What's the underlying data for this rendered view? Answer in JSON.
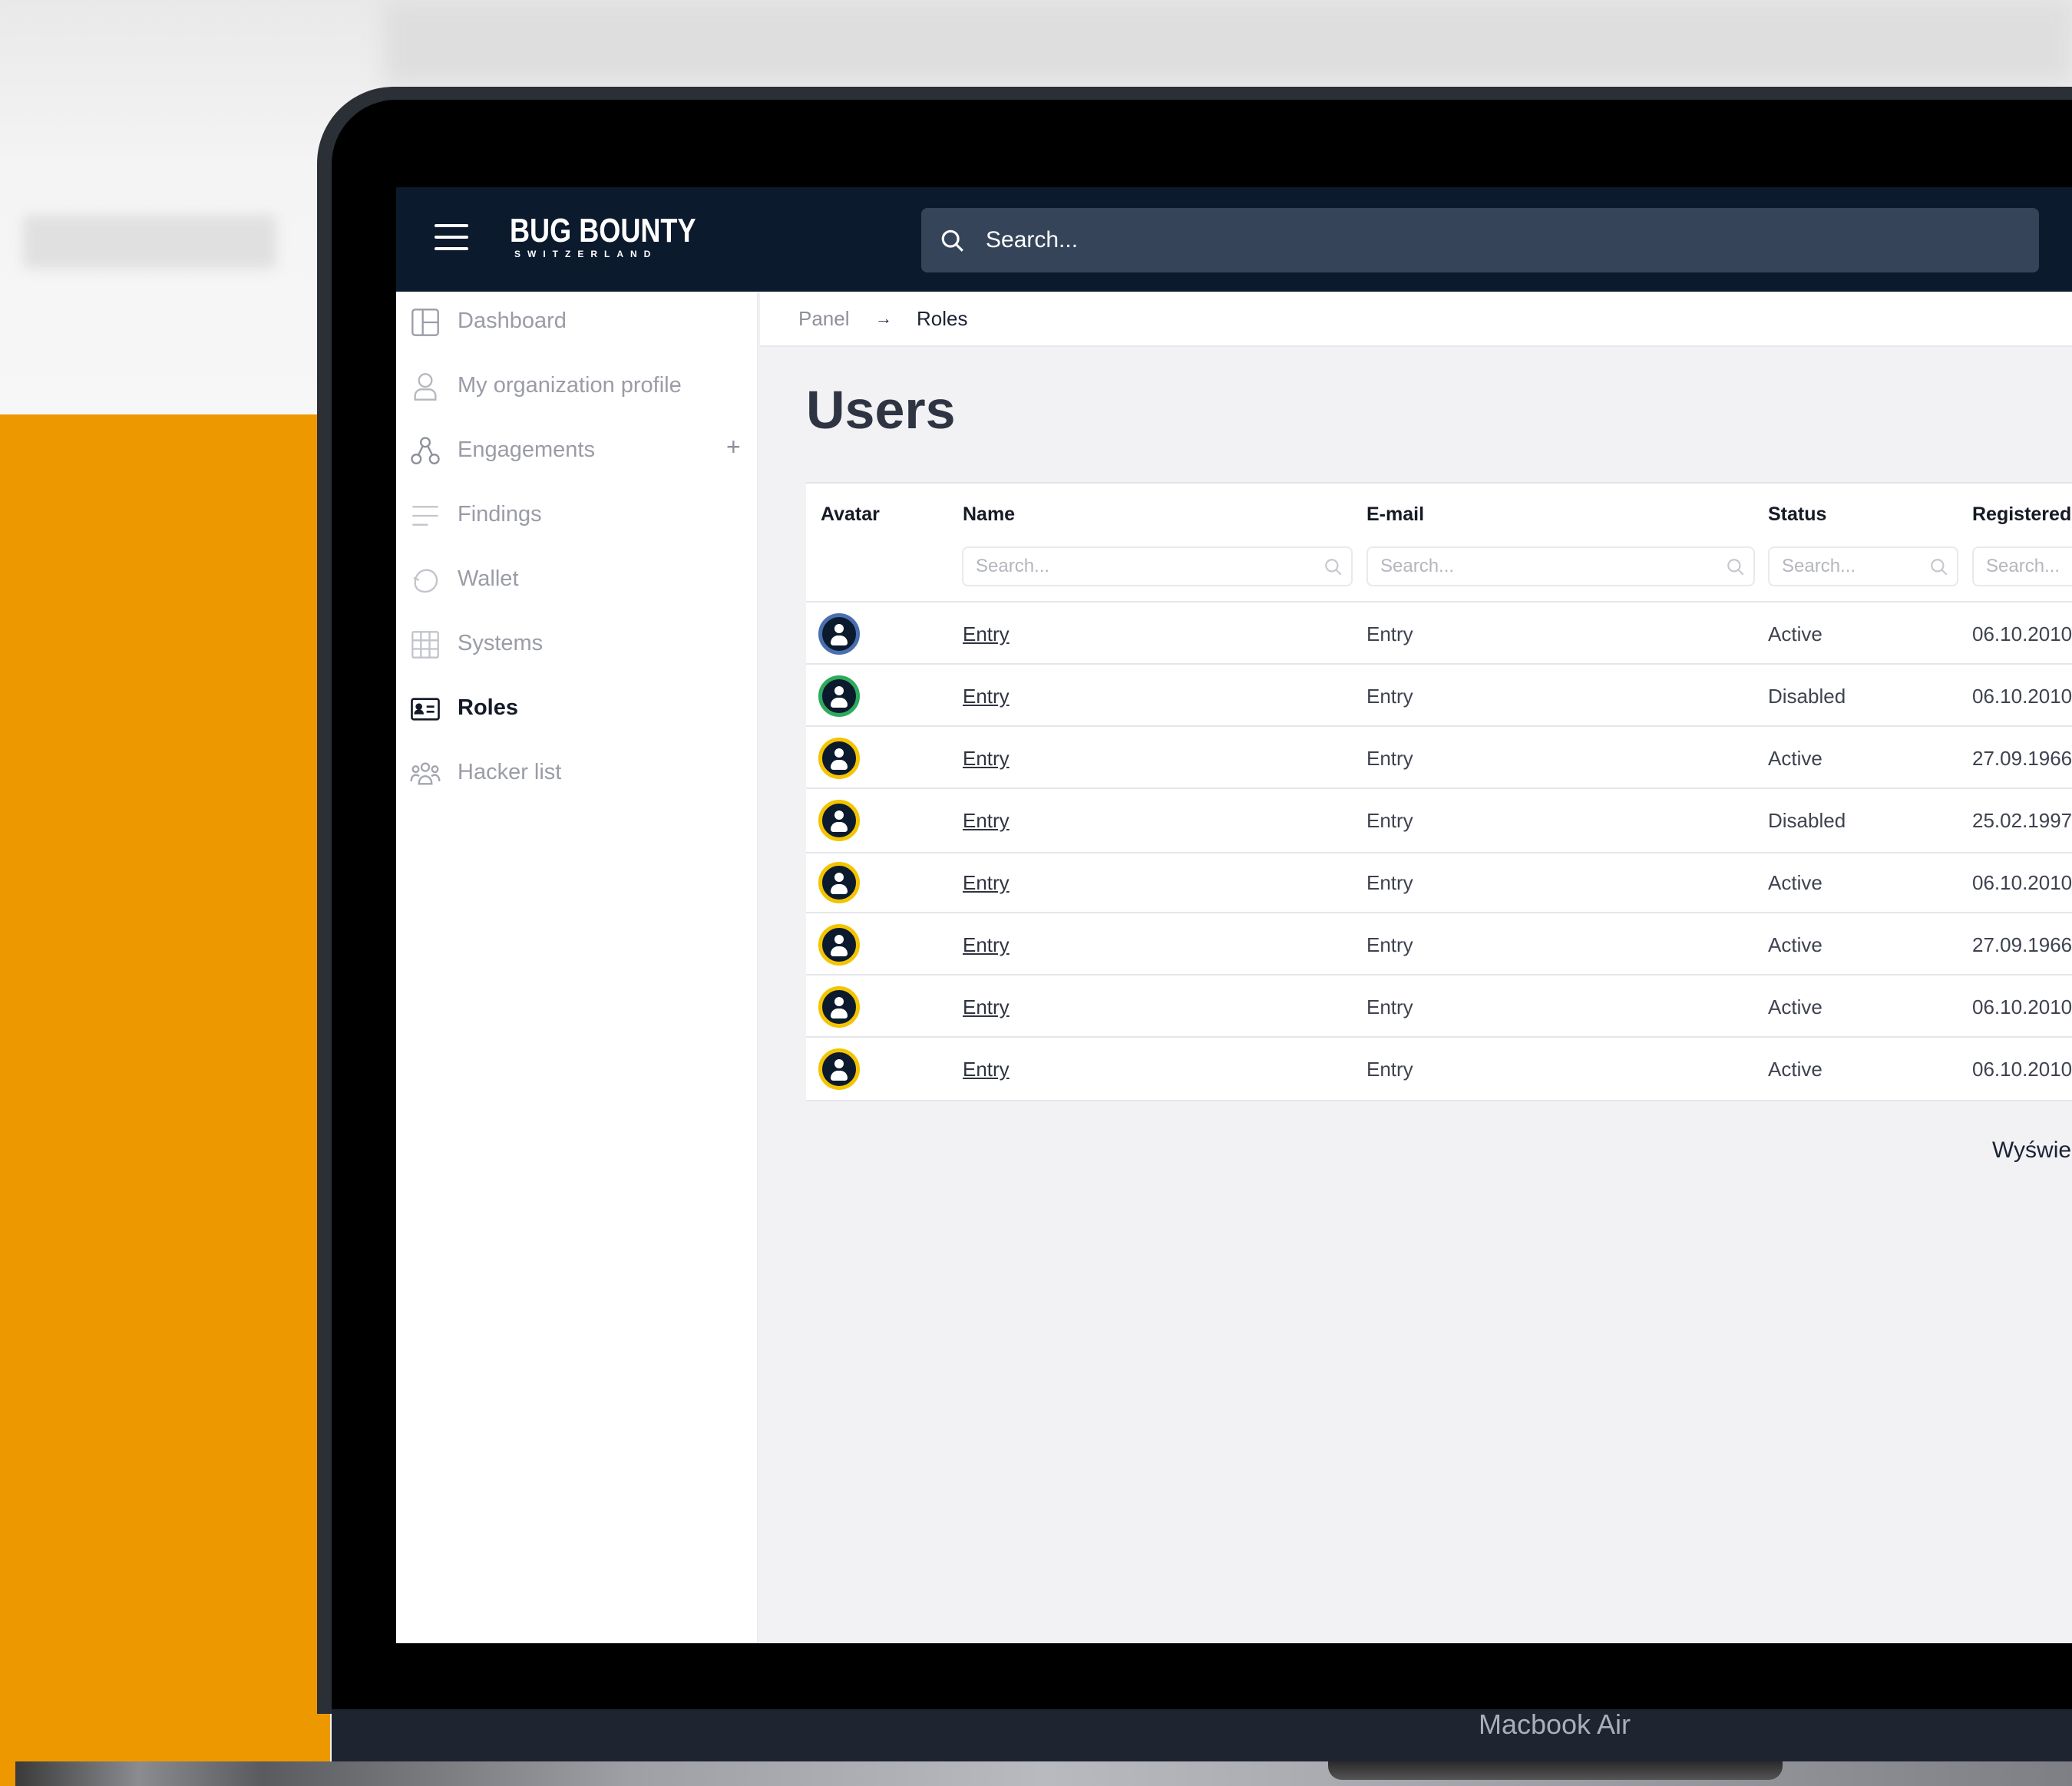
{
  "device_label": "Macbook Air",
  "brand": {
    "name": "BUG BOUNTY",
    "sub": "SWITZERLAND"
  },
  "topbar": {
    "search_placeholder": "Search..."
  },
  "sidebar": {
    "items": [
      {
        "label": "Dashboard",
        "icon": "dashboard-icon"
      },
      {
        "label": "My organization profile",
        "icon": "user-icon"
      },
      {
        "label": "Engagements",
        "icon": "engagements-icon",
        "has_add": true
      },
      {
        "label": "Findings",
        "icon": "list-icon"
      },
      {
        "label": "Wallet",
        "icon": "wallet-icon"
      },
      {
        "label": "Systems",
        "icon": "grid-icon"
      },
      {
        "label": "Roles",
        "icon": "id-card-icon",
        "active": true
      },
      {
        "label": "Hacker list",
        "icon": "people-icon"
      }
    ],
    "add_symbol": "+"
  },
  "breadcrumb": {
    "items": [
      "Panel",
      "Roles"
    ],
    "separator": "→"
  },
  "page": {
    "title": "Users"
  },
  "table": {
    "columns": [
      "Avatar",
      "Name",
      "E-mail",
      "Status",
      "Registered"
    ],
    "filter_placeholder": "Search...",
    "rows": [
      {
        "name": "Entry",
        "email": "Entry",
        "status": "Active",
        "registered": "06.10.2010",
        "ring": "blue"
      },
      {
        "name": "Entry",
        "email": "Entry",
        "status": "Disabled",
        "registered": "06.10.2010",
        "ring": "green"
      },
      {
        "name": "Entry",
        "email": "Entry",
        "status": "Active",
        "registered": "27.09.1966",
        "ring": "yellow"
      },
      {
        "name": "Entry",
        "email": "Entry",
        "status": "Disabled",
        "registered": "25.02.1997",
        "ring": "yellow"
      },
      {
        "name": "Entry",
        "email": "Entry",
        "status": "Active",
        "registered": "06.10.2010",
        "ring": "yellow"
      },
      {
        "name": "Entry",
        "email": "Entry",
        "status": "Active",
        "registered": "27.09.1966",
        "ring": "yellow"
      },
      {
        "name": "Entry",
        "email": "Entry",
        "status": "Active",
        "registered": "06.10.2010",
        "ring": "yellow"
      },
      {
        "name": "Entry",
        "email": "Entry",
        "status": "Active",
        "registered": "06.10.2010",
        "ring": "yellow"
      }
    ]
  },
  "footer": {
    "text": "Wyświe"
  },
  "colors": {
    "navy": "#0c1a2e",
    "accent": "#ee9800",
    "avatar_ring": "#f3c400"
  }
}
